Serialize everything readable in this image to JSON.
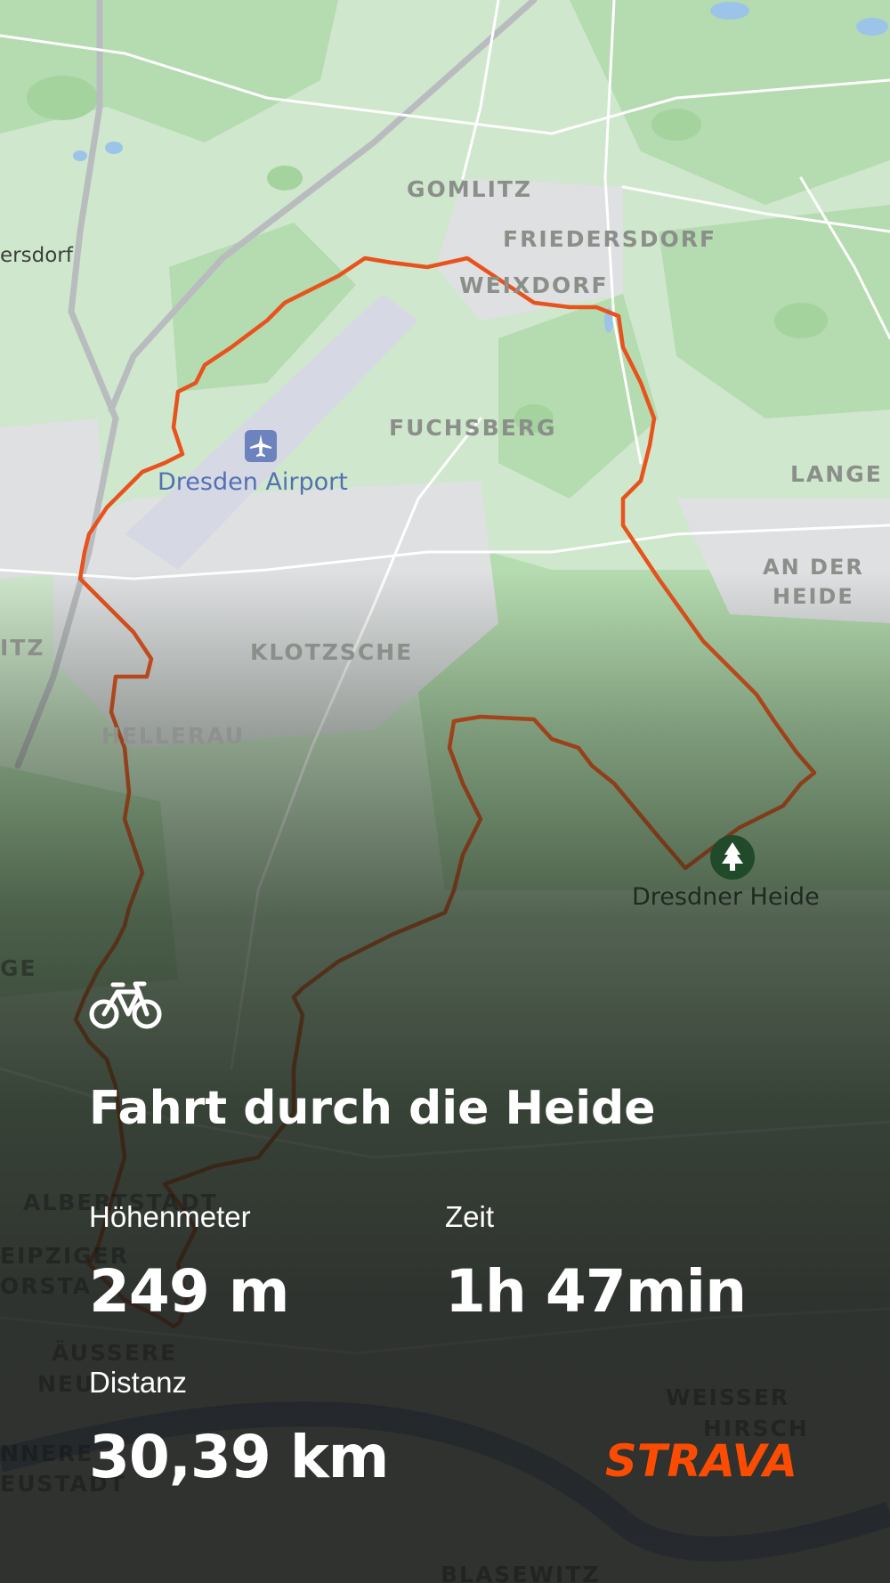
{
  "map": {
    "places": {
      "gomlitz": "GOMLITZ",
      "friedersdorf": "FRIEDERSDORF",
      "weixdorf": "WEIXDORF",
      "ersdorf": "ersdorf",
      "fuchsberg": "FUCHSBERG",
      "lange": "LANGE",
      "an_der": "AN DER",
      "heide": "HEIDE",
      "itz": "ITZ",
      "klotzsche": "KLOTZSCHE",
      "hellerau": "HELLERAU",
      "ge": "GE",
      "albertstadt": "ALBERTSTADT",
      "eipziger": "EIPZIGER",
      "orsta": "ORSTA",
      "aussere": "ÄUSSERE",
      "neu": "NEU",
      "weisser": "WEISSER",
      "hirsch": "HIRSCH",
      "nnere": "NNERE",
      "eustadt": "EUSTADT",
      "blasewitz": "BLASEWITZ"
    },
    "airport_label": "Dresden Airport",
    "airport_icon": "airplane-icon",
    "forest_label": "Dresdner Heide",
    "forest_icon": "tree-icon",
    "route_color": "#e8521c"
  },
  "activity": {
    "type_icon": "bicycle-icon",
    "title": "Fahrt durch die Heide",
    "stats": {
      "elevation_label": "Höhenmeter",
      "elevation_value": "249 m",
      "time_label": "Zeit",
      "time_value": "1h 47min",
      "distance_label": "Distanz",
      "distance_value": "30,39 km"
    }
  },
  "brand": {
    "name": "STRAVA",
    "color": "#fc4c02"
  }
}
